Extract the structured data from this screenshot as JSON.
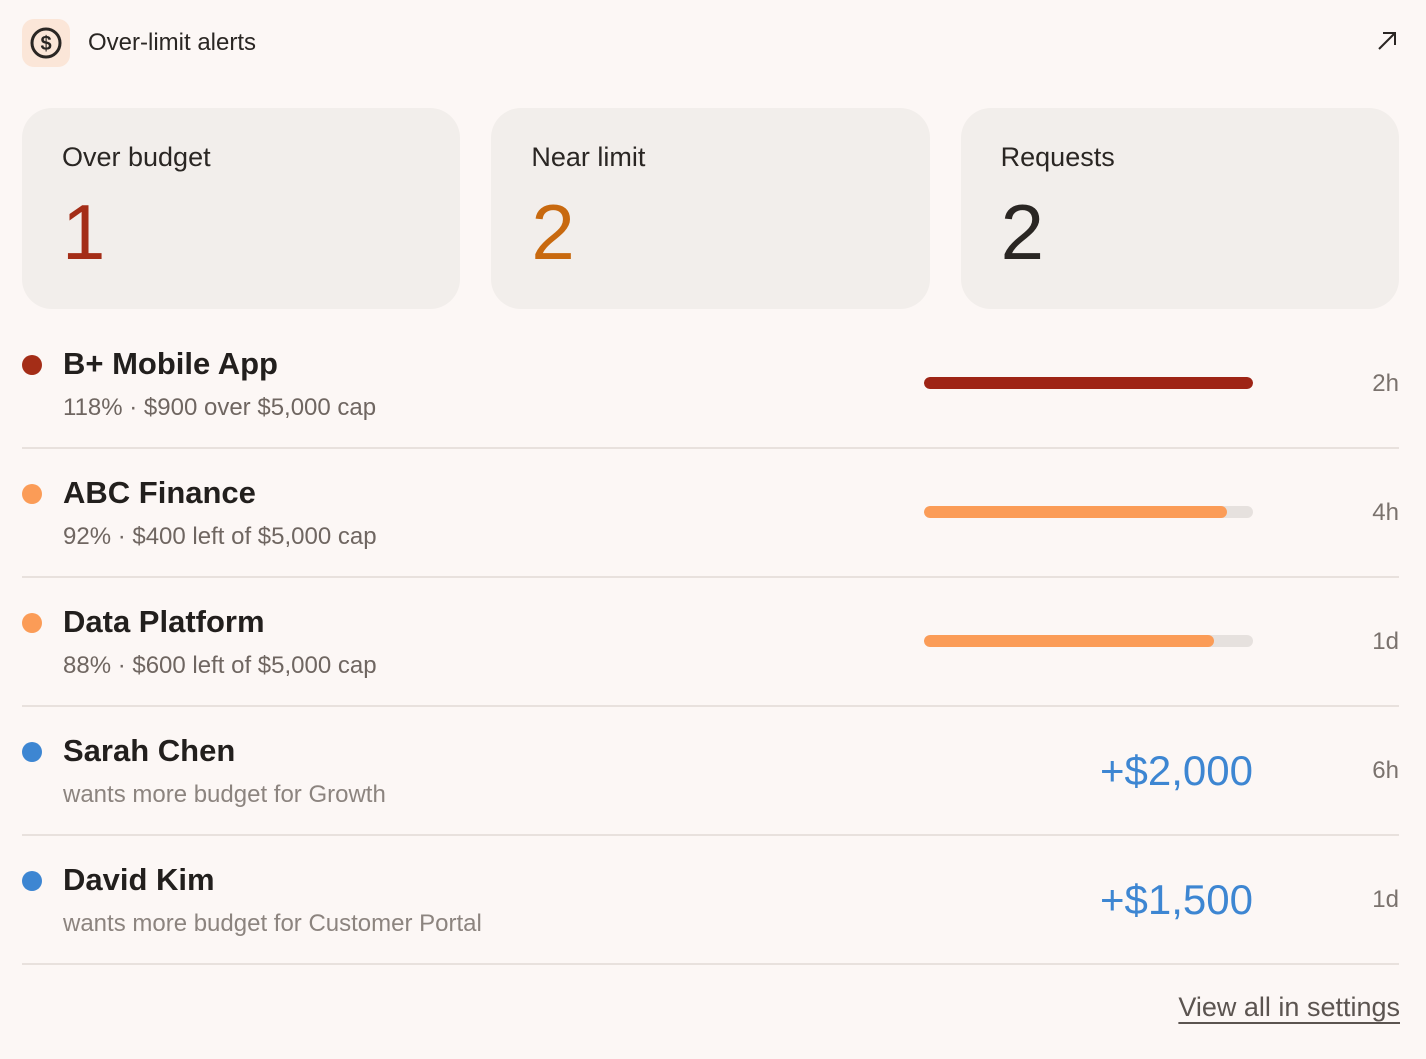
{
  "header": {
    "icon": "dollar-circle-icon",
    "title": "Over-limit alerts",
    "expand_icon": "arrow-up-right-icon"
  },
  "stats": [
    {
      "label": "Over budget",
      "value": "1",
      "color": "#a42d17"
    },
    {
      "label": "Near limit",
      "value": "2",
      "color": "#c8690f"
    },
    {
      "label": "Requests",
      "value": "2",
      "color": "#2a2623"
    }
  ],
  "rows": [
    {
      "title": "B+ Mobile App",
      "subtitle": "118% · $900 over $5,000 cap",
      "dot_color": "#a42d17",
      "progress": 1.0,
      "bar_color": "#9e2415",
      "time": "2h"
    },
    {
      "title": "ABC Finance",
      "subtitle": "92% · $400 left of $5,000 cap",
      "dot_color": "#fb9c57",
      "progress": 0.92,
      "bar_color": "#fb9c57",
      "time": "4h"
    },
    {
      "title": "Data Platform",
      "subtitle": "88% · $600 left of $5,000 cap",
      "dot_color": "#fb9c57",
      "progress": 0.88,
      "bar_color": "#fb9c57",
      "time": "1d"
    },
    {
      "title": "Sarah Chen",
      "subtitle": "wants more budget for Growth",
      "dot_color": "#3d86d2",
      "amount": "+$2,000",
      "time": "6h"
    },
    {
      "title": "David Kim",
      "subtitle": "wants more budget for Customer Portal",
      "dot_color": "#3d86d2",
      "amount": "+$1,500",
      "time": "1d"
    }
  ],
  "footer": {
    "link_label": "View all in settings"
  }
}
